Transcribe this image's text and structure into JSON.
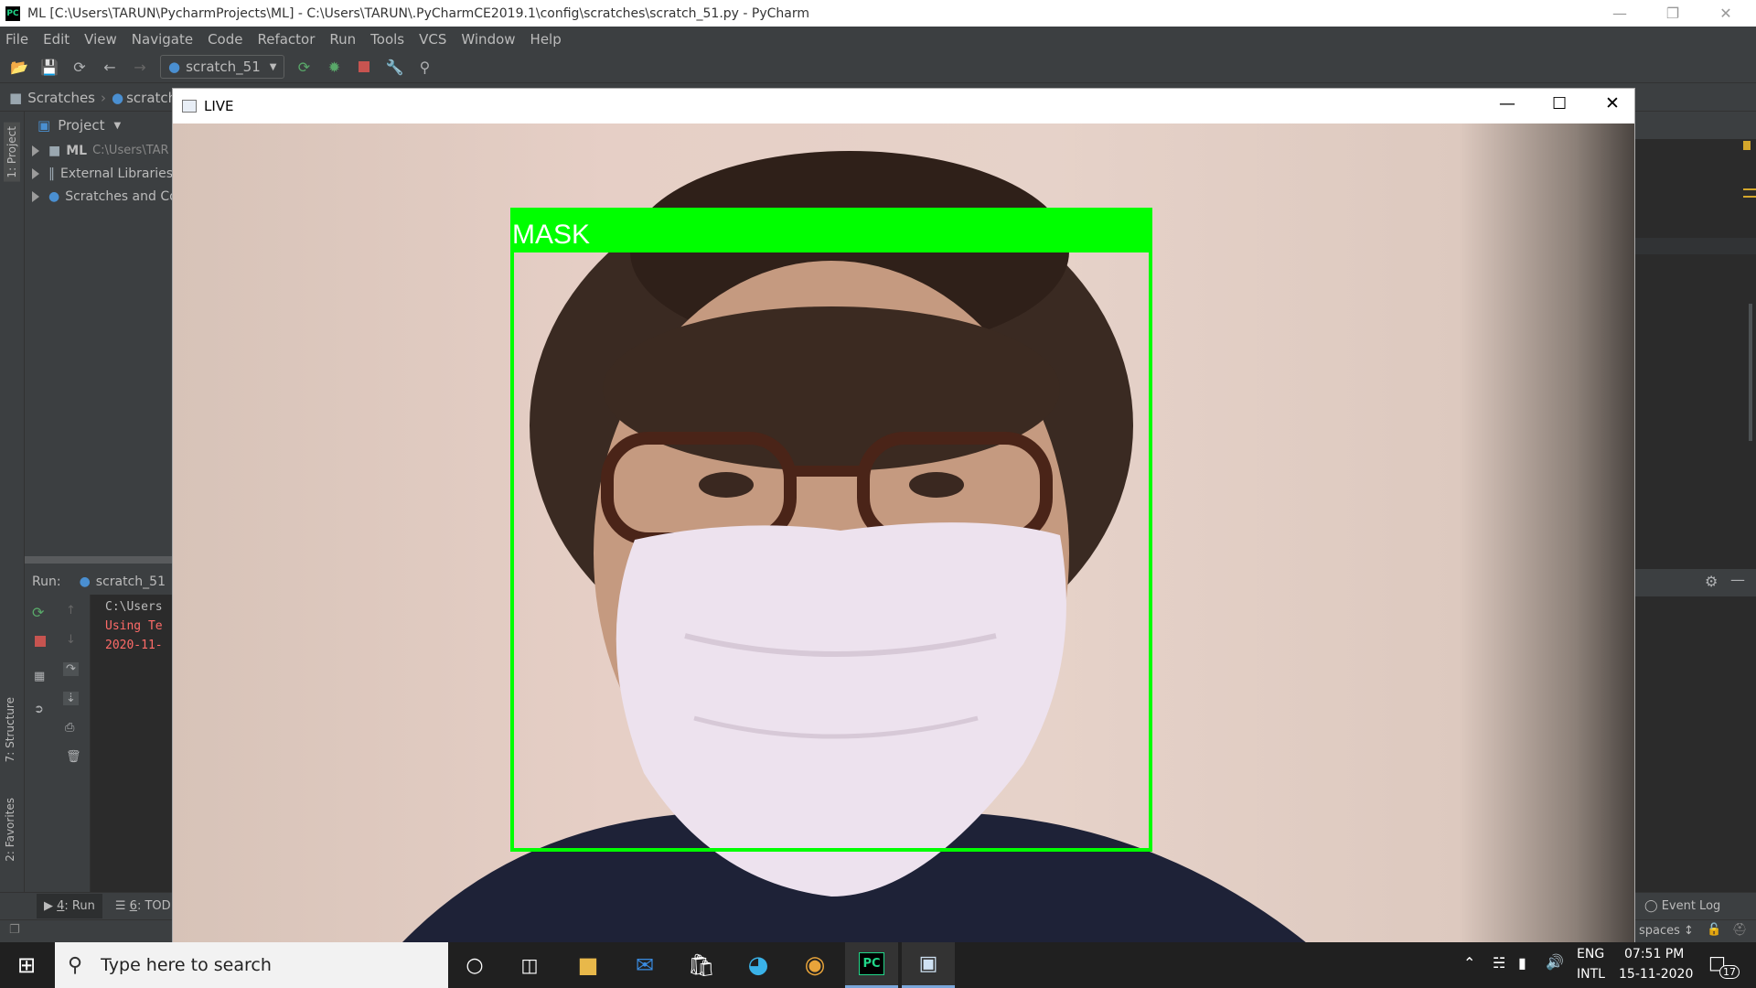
{
  "window": {
    "title": "ML [C:\\Users\\TARUN\\PycharmProjects\\ML] - C:\\Users\\TARUN\\.PyCharmCE2019.1\\config\\scratches\\scratch_51.py - PyCharm"
  },
  "menu": [
    "File",
    "Edit",
    "View",
    "Navigate",
    "Code",
    "Refactor",
    "Run",
    "Tools",
    "VCS",
    "Window",
    "Help"
  ],
  "toolbar": {
    "run_config": "scratch_51"
  },
  "navbar": {
    "crumb1": "Scratches",
    "crumb2": "scratch_"
  },
  "project": {
    "header": "Project",
    "items": [
      {
        "label": "ML",
        "path": "C:\\Users\\TAR"
      },
      {
        "label": "External Libraries"
      },
      {
        "label": "Scratches and Co"
      }
    ]
  },
  "tool_tabs": {
    "project": "1: Project",
    "structure": "7: Structure",
    "favorites": "2: Favorites"
  },
  "run": {
    "label": "Run:",
    "tab": "scratch_51",
    "console": [
      "C:\\Users",
      "Using Te",
      "2020-11-"
    ]
  },
  "bottom_tabs": [
    {
      "key": "4",
      "label": ": Run"
    },
    {
      "key": "6",
      "label": ": TOD"
    }
  ],
  "status": {
    "event_log": "Event Log",
    "indent": "spaces ↕"
  },
  "live": {
    "title": "LIVE",
    "detection_label": "MASK",
    "box_color": "#00ff00"
  },
  "taskbar": {
    "search_placeholder": "Type here to search",
    "lang_top": "ENG",
    "lang_bottom": "INTL",
    "time": "07:51 PM",
    "date": "15-11-2020",
    "notifications": "17"
  },
  "colors": {
    "ide_bg": "#3c3f41",
    "editor_bg": "#2b2b2b",
    "console_error": "#ff6b68",
    "run_green": "#499c54"
  }
}
